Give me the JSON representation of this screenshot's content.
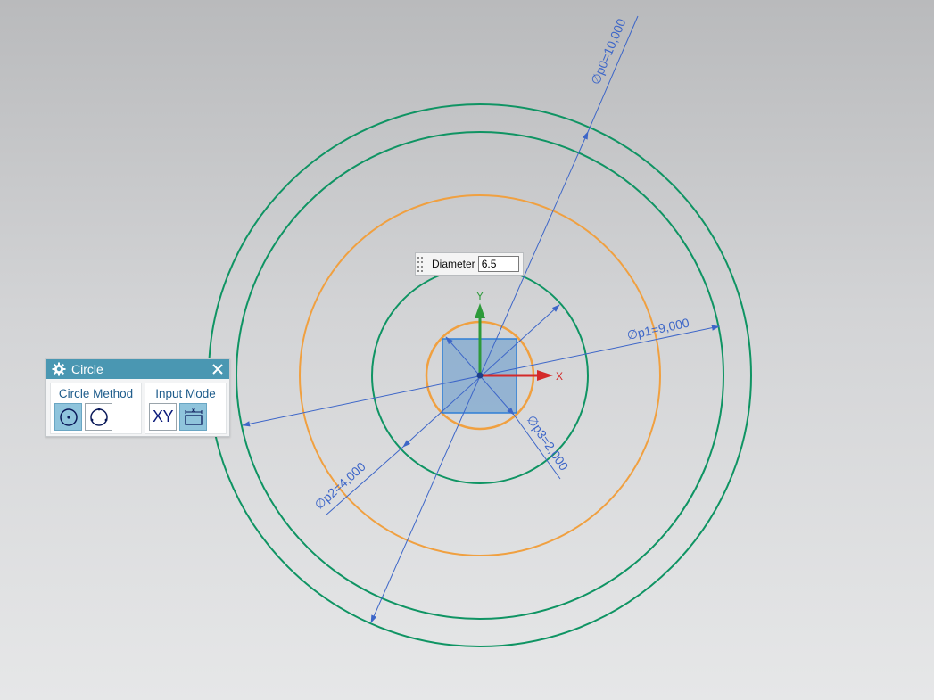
{
  "dialog": {
    "title": "Circle",
    "title_icon": "gear-icon",
    "close_icon": "close-icon",
    "circle_method": {
      "label": "Circle Method",
      "options": [
        {
          "name": "center-point-circle",
          "icon": "center-point-circle-icon",
          "active": true
        },
        {
          "name": "three-point-circle",
          "icon": "three-point-circle-icon",
          "active": false
        }
      ]
    },
    "input_mode": {
      "label": "Input Mode",
      "options": [
        {
          "name": "coordinate-mode",
          "text": "XY",
          "active": false
        },
        {
          "name": "parameter-mode",
          "icon": "parameter-mode-icon",
          "active": true
        }
      ]
    }
  },
  "diameter_input": {
    "label": "Diameter",
    "value": "6.5"
  },
  "dimensions": {
    "p0": "∅p0=10,000",
    "p1": "∅p1=9,000",
    "p2": "∅p2=4,000",
    "p3": "∅p3=2,000"
  },
  "axes": {
    "x_label": "X",
    "y_label": "Y"
  },
  "colors": {
    "constrained_circle": "#0f9463",
    "preview_circle": "#f0a040",
    "dimension": "#3d66c8",
    "x_axis": "#d42a2a",
    "y_axis": "#2d9a3a",
    "dialog_header": "#4a97b2",
    "selection_box": "#7ea7cf"
  }
}
